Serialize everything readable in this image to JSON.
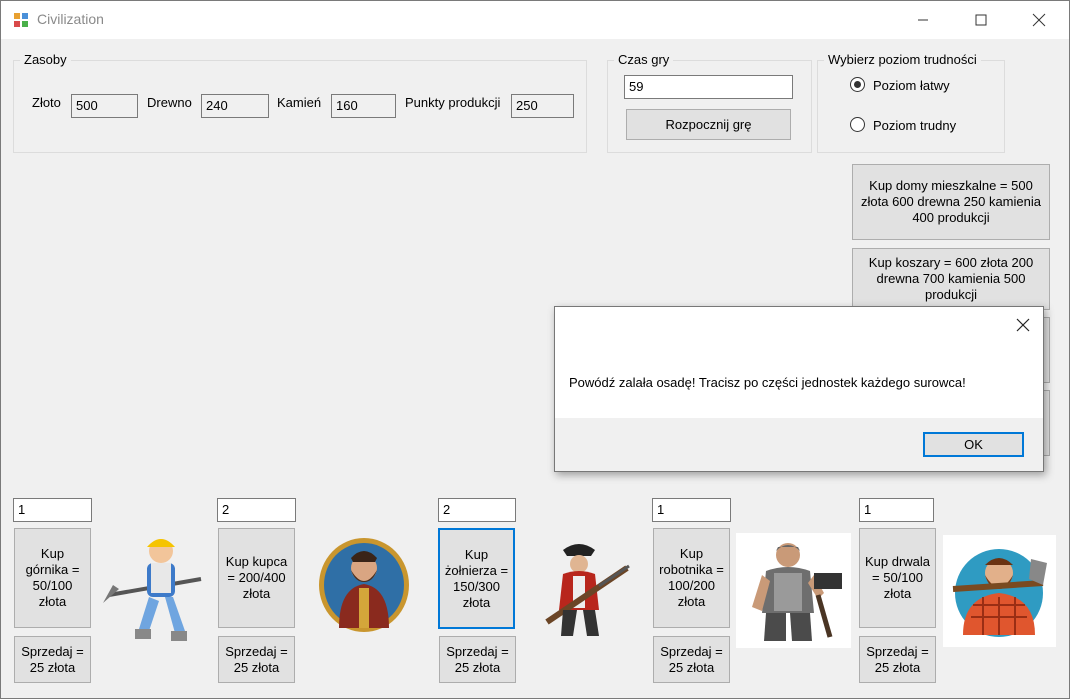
{
  "window": {
    "title": "Civilization"
  },
  "resources": {
    "group_title": "Zasoby",
    "gold_label": "Złoto",
    "gold_value": "500",
    "wood_label": "Drewno",
    "wood_value": "240",
    "stone_label": "Kamień",
    "stone_value": "160",
    "production_label": "Punkty produkcji",
    "production_value": "250"
  },
  "game_time": {
    "group_title": "Czas gry",
    "value": "59",
    "start_label": "Rozpocznij grę"
  },
  "difficulty": {
    "group_title": "Wybierz poziom trudności",
    "easy_label": "Poziom łatwy",
    "hard_label": "Poziom trudny",
    "selected": "easy"
  },
  "buildings": {
    "houses_label": "Kup domy mieszkalne = 500 złota 600 drewna 250 kamienia 400 produkcji",
    "barracks_label": "Kup koszary = 600 złota 200 drewna 700 kamienia 500 produkcji"
  },
  "units": [
    {
      "count": "1",
      "buy_label": "Kup górnika = 50/100 złota",
      "sell_label": "Sprzedaj = 25 złota",
      "icon": "miner-icon"
    },
    {
      "count": "2",
      "buy_label": "Kup kupca = 200/400 złota",
      "sell_label": "Sprzedaj = 25 złota",
      "icon": "merchant-icon"
    },
    {
      "count": "2",
      "buy_label": "Kup żołnierza = 150/300 złota",
      "sell_label": "Sprzedaj = 25 złota",
      "icon": "soldier-icon"
    },
    {
      "count": "1",
      "buy_label": "Kup robotnika = 100/200 złota",
      "sell_label": "Sprzedaj = 25 złota",
      "icon": "worker-icon"
    },
    {
      "count": "1",
      "buy_label": "Kup drwala = 50/100 złota",
      "sell_label": "Sprzedaj = 25 złota",
      "icon": "lumberjack-icon"
    }
  ],
  "dialog": {
    "message": "Powódź zalała osadę! Tracisz po  części jednostek każdego surowca!",
    "ok_label": "OK"
  },
  "colors": {
    "accent": "#0078d7",
    "window_bg": "#f0f0f0",
    "button_bg": "#e1e1e1"
  }
}
